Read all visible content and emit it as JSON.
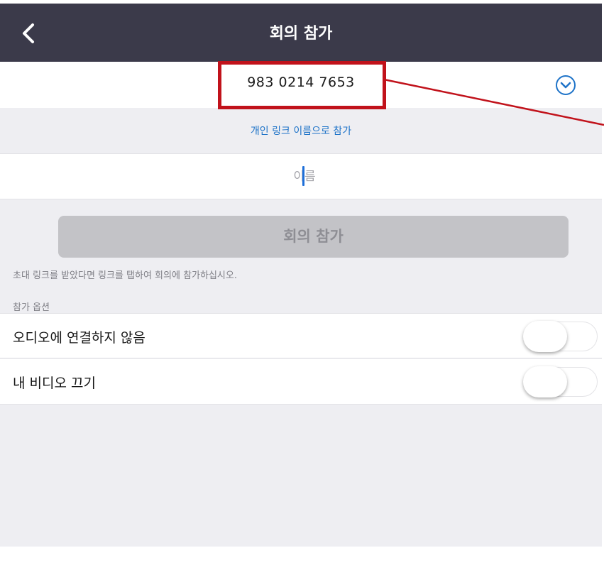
{
  "header": {
    "title": "회의 참가",
    "back_icon": "chevron-left-icon"
  },
  "meeting": {
    "id_value": "983 0214 7653",
    "dropdown_icon": "chevron-down-circle-icon"
  },
  "link_name_join_label": "개인 링크 이름으로 참가",
  "name_field": {
    "placeholder": "이름",
    "value": ""
  },
  "join_button_label": "회의 참가",
  "invite_hint": "초대 링크를 받았다면 링크를 탭하여 회의에 참가하십시오.",
  "options": {
    "header": "참가 옵션",
    "items": [
      {
        "label": "오디오에 연결하지 않음",
        "enabled": false
      },
      {
        "label": "내 비디오 끄기",
        "enabled": false
      }
    ]
  },
  "colors": {
    "navbar": "#3b3a4a",
    "link_blue": "#1e73c8",
    "annotation_red": "#c1121b",
    "disabled_button": "#c3c3c7"
  }
}
